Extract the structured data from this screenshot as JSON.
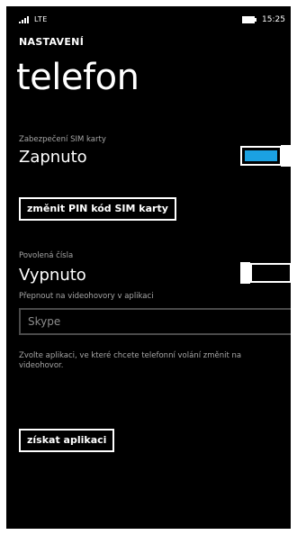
{
  "status_bar": {
    "network": "LTE",
    "time": "15:25",
    "signal_icon": "signal-bars-icon",
    "battery_icon": "battery-icon"
  },
  "header": {
    "section": "NASTAVENÍ",
    "title": "telefon"
  },
  "sim_security": {
    "caption": "Zabezpečení SIM karty",
    "value": "Zapnuto",
    "on": true,
    "accent": "#1ba1e2"
  },
  "change_pin_button": {
    "label": "změnit PIN kód SIM karty"
  },
  "fixed_dialing": {
    "caption": "Povolená čísla",
    "value": "Vypnuto",
    "on": false
  },
  "video_call_app": {
    "caption": "Přepnout na videohovory v aplikaci",
    "placeholder": "Skype",
    "help": "Zvolte aplikaci, ve které chcete telefonní volání změnit na videohovor."
  },
  "get_apps_button": {
    "label": "získat aplikaci"
  }
}
